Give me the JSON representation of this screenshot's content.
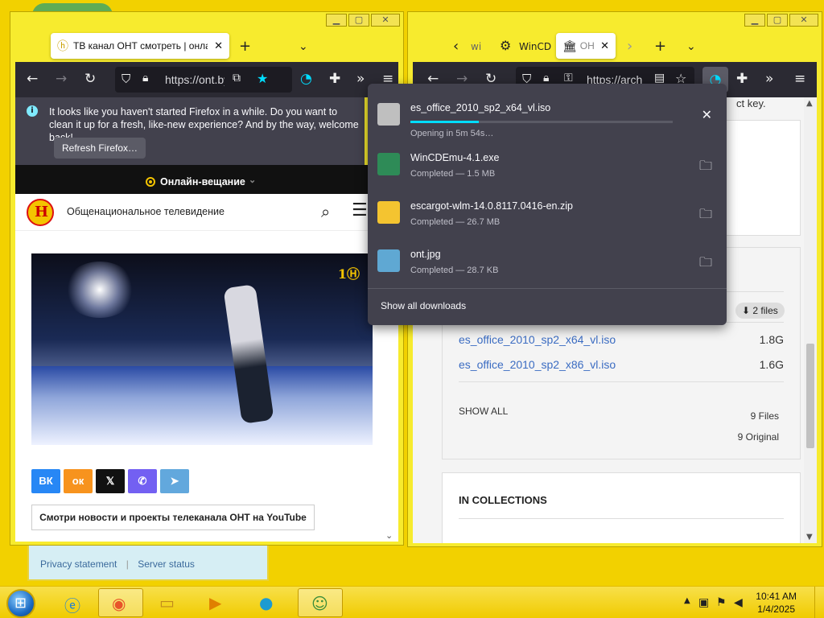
{
  "left_window": {
    "tab": {
      "title": "ТВ канал ОНТ смотреть | онлайн",
      "icon": "tab-favicon-icon"
    },
    "url": "https://ont.by",
    "notification": {
      "message": "It looks like you haven't started Firefox in a while. Do you want to clean it up for a fresh, like-new experience? And by the way, welcome back!",
      "button": "Refresh Firefox…"
    },
    "page": {
      "live_label": "Онлайн-вещание",
      "site_name": "Общенациональное телевидение",
      "share": [
        "ВК",
        "ок",
        "𝕏",
        "✆",
        "➤"
      ],
      "share_colors": [
        "#2787f5",
        "#f7931e",
        "#111111",
        "#7360f2",
        "#62a8dd"
      ],
      "youtube_button": "Смотри новости и проекты телеканала ОНТ на YouTube"
    }
  },
  "right_window": {
    "tabs": [
      "wi",
      "WinCD",
      "ОН"
    ],
    "url": "https://arch",
    "fragment_text": "ct key.",
    "files_pill": "⬇ 2 files",
    "files": [
      {
        "name": "es_office_2010_sp2_x64_vl.iso",
        "size": "1.8G"
      },
      {
        "name": "es_office_2010_sp2_x86_vl.iso",
        "size": "1.6G"
      }
    ],
    "show_all": "SHOW ALL",
    "count_files": "9 Files",
    "count_original": "9 Original",
    "collections_heading": "IN COLLECTIONS"
  },
  "downloads": {
    "items": [
      {
        "name": "es_office_2010_sp2_x64_vl.iso",
        "status": "Opening in 5m 54s…",
        "progress": 0.26,
        "action": "cancel-icon",
        "icon_color": "#bfbfbf"
      },
      {
        "name": "WinCDEmu-4.1.exe",
        "status": "Completed — 1.5 MB",
        "action": "folder-icon",
        "icon_color": "#2e8b57"
      },
      {
        "name": "escargot-wlm-14.0.8117.0416-en.zip",
        "status": "Completed — 26.7 MB",
        "action": "folder-icon",
        "icon_color": "#f4c430"
      },
      {
        "name": "ont.jpg",
        "status": "Completed — 28.7 KB",
        "action": "folder-icon",
        "icon_color": "#5fa8d3"
      }
    ],
    "footer": "Show all downloads"
  },
  "behind_window": {
    "links": [
      "Privacy statement",
      "Server status"
    ]
  },
  "taskbar": {
    "time": "10:41 AM",
    "date": "1/4/2025"
  }
}
